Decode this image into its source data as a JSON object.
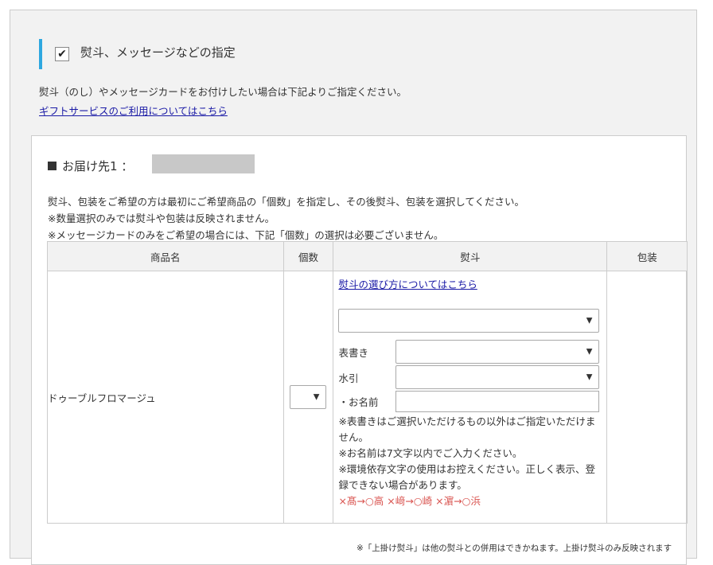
{
  "section": {
    "title": "熨斗、メッセージなどの指定",
    "checked": true,
    "intro_text": "熨斗（のし）やメッセージカードをお付けしたい場合は下記よりご指定ください。",
    "intro_link": "ギフトサービスのご利用についてはこちら",
    "accent_color": "#2ea7e0"
  },
  "destination": {
    "label": "お届け先1 ：",
    "notes": [
      "熨斗、包装をご希望の方は最初にご希望商品の「個数」を指定し、その後熨斗、包装を選択してください。",
      "※数量選択のみでは熨斗や包装は反映されません。",
      "※メッセージカードのみをご希望の場合には、下記「個数」の選択は必要ございません。"
    ]
  },
  "table": {
    "headers": [
      "商品名",
      "個数",
      "熨斗",
      "包装"
    ],
    "rows": [
      {
        "product": "ドゥーブルフロマージュ",
        "quantity_value": "",
        "noshi": {
          "link": "熨斗の選び方についてはこちら",
          "main_select_value": "",
          "omote_label": "表書き",
          "omote_value": "",
          "mizuhiki_label": "水引",
          "mizuhiki_value": "",
          "name_label": "・お名前",
          "name_value": "",
          "notes": [
            "※表書きはご選択いただけるもの以外はご指定いただけません。",
            "※お名前は7文字以内でご入力ください。",
            "※環境依存文字の使用はお控えください。正しく表示、登録できない場合があります。"
          ],
          "examples": "×髙→○高 ×﨑→○崎 ×濵→○浜"
        },
        "wrapping": ""
      }
    ]
  },
  "footnote": "※「上掛け熨斗」は他の熨斗との併用はできかねます。上掛け熨斗のみ反映されます",
  "icons": {
    "check": "checkmark-icon",
    "dropdown": "chevron-down-icon",
    "bullet": "square-bullet-icon"
  }
}
